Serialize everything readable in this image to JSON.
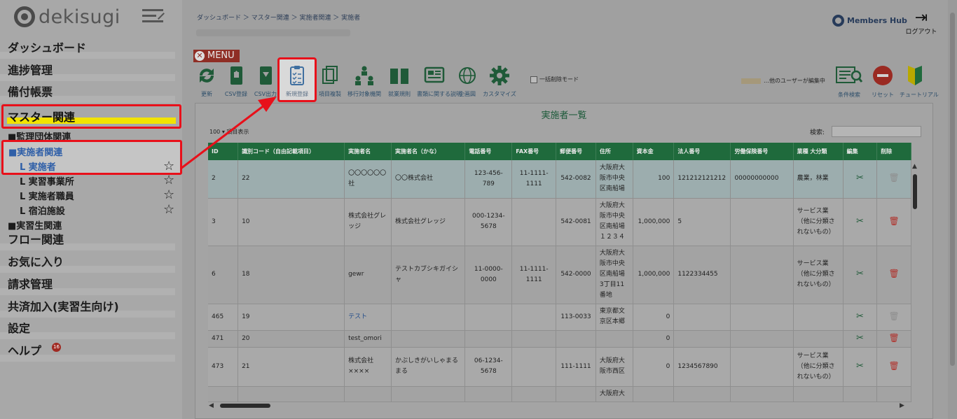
{
  "app": {
    "logo": "dekisugi"
  },
  "sidebar": {
    "items": [
      {
        "label": "ダッシュボード"
      },
      {
        "label": "進捗管理"
      },
      {
        "label": "備付帳票"
      },
      {
        "label": "マスター関連"
      },
      {
        "label": "■監理団体関連"
      },
      {
        "label": "■実施者関連"
      },
      {
        "label": "L 実施者"
      },
      {
        "label": "L 実習事業所"
      },
      {
        "label": "L 実施者職員"
      },
      {
        "label": "L 宿泊施設"
      },
      {
        "label": "■実習生関連"
      },
      {
        "label": "フロー関連"
      },
      {
        "label": "お気に入り"
      },
      {
        "label": "請求管理"
      },
      {
        "label": "共済加入(実習生向け)"
      },
      {
        "label": "設定"
      },
      {
        "label": "ヘルプ"
      }
    ],
    "help_badge": "16"
  },
  "header": {
    "breadcrumb": "ダッシュボード ＞ マスター関連 ＞ 実施者関連 ＞ 実施者",
    "brand": "Members Hub",
    "logout": "ログアウト"
  },
  "toolbar": {
    "menu": "MENU",
    "tools": [
      "更新",
      "CSV登録",
      "CSV出力",
      "新規登録",
      "項目複製",
      "移行対象機関",
      "就業規則",
      "書類に関する説明",
      "企画図",
      "カスタマイズ"
    ],
    "bulk_delete": "一括削除モード",
    "others_editing": "…他のユーザーが編集中",
    "condition_search": "条件検索",
    "reset": "リセット",
    "tutorial": "チュートリアル"
  },
  "panel": {
    "title": "実施者一覧",
    "length_text": "100 ▾ 項目表示",
    "search_label": "検索:",
    "search_value": ""
  },
  "table": {
    "headers": [
      "ID",
      "識別コード（自由記載項目）",
      "実施者名",
      "実施者名（かな）",
      "電話番号",
      "FAX番号",
      "郵便番号",
      "住所",
      "資本金",
      "法人番号",
      "労働保険番号",
      "業種 大分類",
      "編集",
      "削除"
    ],
    "rows": [
      [
        "2",
        "22",
        "〇〇〇〇〇〇社",
        "〇〇株式会社",
        "123-456-789",
        "11-1111-1111",
        "542-0082",
        "大阪府大阪市中央区南船場",
        "100",
        "121212121212",
        "00000000000",
        "農業，林業"
      ],
      [
        "3",
        "10",
        "株式会社グレッジ",
        "株式会社グレッジ",
        "000-1234-5678",
        "",
        "542-0081",
        "大阪府大阪市中央区南船場１２３４",
        "1,000,000",
        "5",
        "",
        "サービス業（他に分類されないもの）"
      ],
      [
        "6",
        "18",
        "gewr",
        "テストカブシキガイシャ",
        "11-0000-0000",
        "11-1111-1111",
        "542-0000",
        "大阪府大阪市中央区南船場3丁目11番地",
        "1,000,000",
        "1122334455",
        "",
        "サービス業（他に分類されないもの）"
      ],
      [
        "465",
        "19",
        "テスト",
        "",
        "",
        "",
        "113-0033",
        "東京都文京区本郷",
        "0",
        "",
        "",
        ""
      ],
      [
        "471",
        "20",
        "test_omori",
        "",
        "",
        "",
        "",
        "",
        "0",
        "",
        "",
        ""
      ],
      [
        "473",
        "21",
        "株式会社××××",
        "かぶしきがいしゃまるまる",
        "06-1234-5678",
        "",
        "111-1111",
        "大阪府大阪市西区",
        "0",
        "1234567890",
        "",
        "サービス業（他に分類されないもの）"
      ],
      [
        "",
        "",
        "",
        "",
        "",
        "",
        "",
        "大阪府大",
        "",
        "",
        "",
        ""
      ]
    ]
  },
  "colors": {
    "table_header": "#1f6a3c",
    "highlight": "#e8101a",
    "accent_yellow": "#f2e300"
  }
}
